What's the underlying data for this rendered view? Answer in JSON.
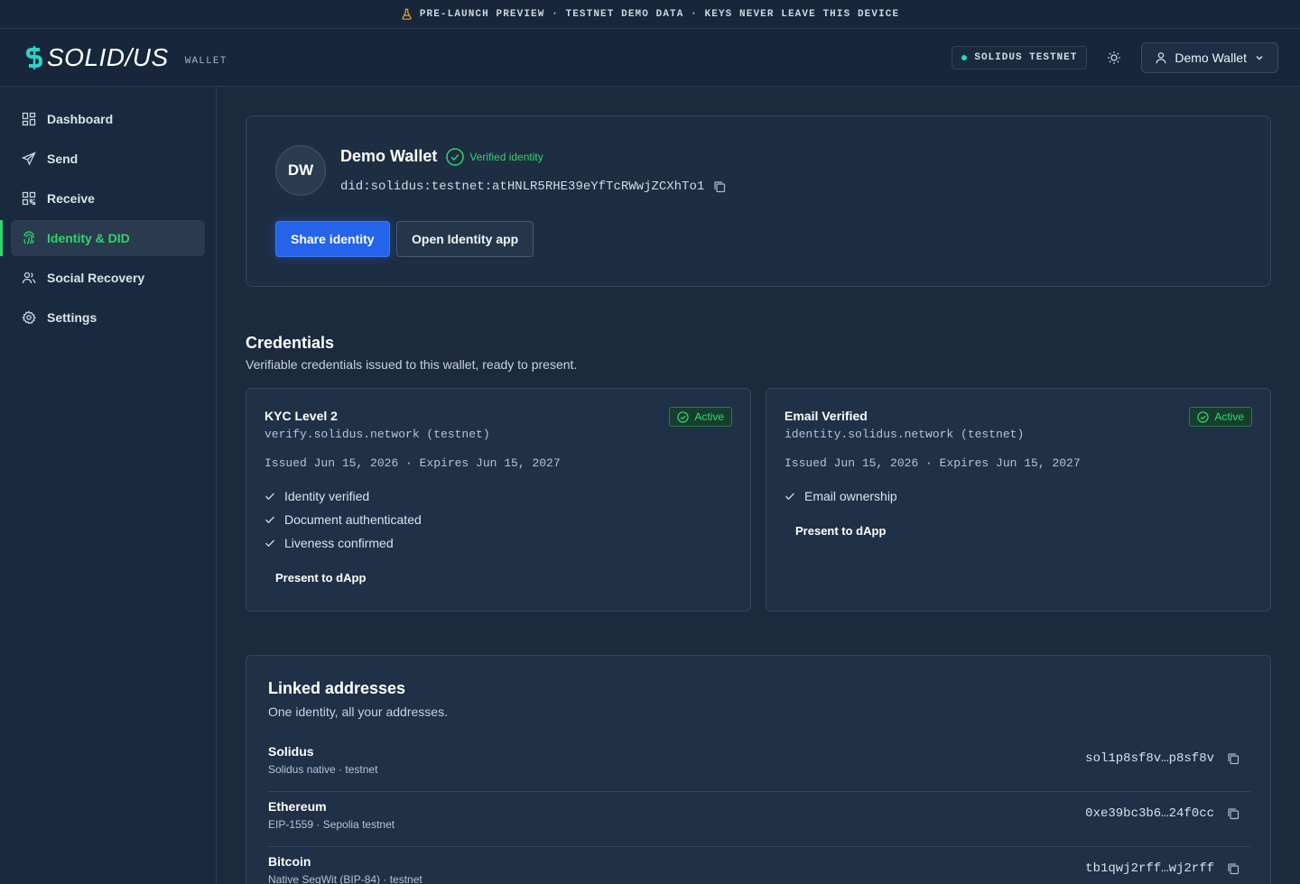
{
  "banner": {
    "text": "PRE-LAUNCH PREVIEW · TESTNET DEMO DATA · KEYS NEVER LEAVE THIS DEVICE",
    "icon": "flask-icon"
  },
  "header": {
    "logo_text": "SOLID/US",
    "product_tag": "WALLET",
    "network_label": "SOLIDUS TESTNET",
    "account_label": "Demo Wallet"
  },
  "sidebar": {
    "items": [
      {
        "label": "Dashboard",
        "icon": "grid-icon",
        "active": false
      },
      {
        "label": "Send",
        "icon": "send-icon",
        "active": false
      },
      {
        "label": "Receive",
        "icon": "qr-icon",
        "active": false
      },
      {
        "label": "Identity & DID",
        "icon": "fingerprint-icon",
        "active": true
      },
      {
        "label": "Social Recovery",
        "icon": "users-icon",
        "active": false
      },
      {
        "label": "Settings",
        "icon": "gear-icon",
        "active": false
      }
    ]
  },
  "identity": {
    "initials": "DW",
    "name": "Demo Wallet",
    "verified_label": "Verified identity",
    "did": "did:solidus:testnet:atHNLR5RHE39eYfTcRWwjZCXhTo1",
    "share_label": "Share identity",
    "open_label": "Open Identity app"
  },
  "credentials": {
    "title": "Credentials",
    "subtitle": "Verifiable credentials issued to this wallet, ready to present.",
    "items": [
      {
        "title": "KYC Level 2",
        "issuer": "verify.solidus.network (testnet)",
        "dates": "Issued Jun 15, 2026 · Expires Jun 15, 2027",
        "status": "Active",
        "claims": [
          "Identity verified",
          "Document authenticated",
          "Liveness confirmed"
        ],
        "action": "Present to dApp"
      },
      {
        "title": "Email Verified",
        "issuer": "identity.solidus.network (testnet)",
        "dates": "Issued Jun 15, 2026 · Expires Jun 15, 2027",
        "status": "Active",
        "claims": [
          "Email ownership"
        ],
        "action": "Present to dApp"
      }
    ]
  },
  "linked": {
    "title": "Linked addresses",
    "subtitle": "One identity, all your addresses.",
    "rows": [
      {
        "name": "Solidus",
        "meta": "Solidus native · testnet",
        "address": "sol1p8sf8v…p8sf8v"
      },
      {
        "name": "Ethereum",
        "meta": "EIP-1559 · Sepolia testnet",
        "address": "0xe39bc3b6…24f0cc"
      },
      {
        "name": "Bitcoin",
        "meta": "Native SegWit (BIP-84) · testnet",
        "address": "tb1qwj2rff…wj2rff"
      }
    ]
  },
  "colors": {
    "accent_green": "#30d56b",
    "primary_blue": "#2563eb",
    "network_dot": "#2ed3c6",
    "background": "#1b2a3d"
  }
}
